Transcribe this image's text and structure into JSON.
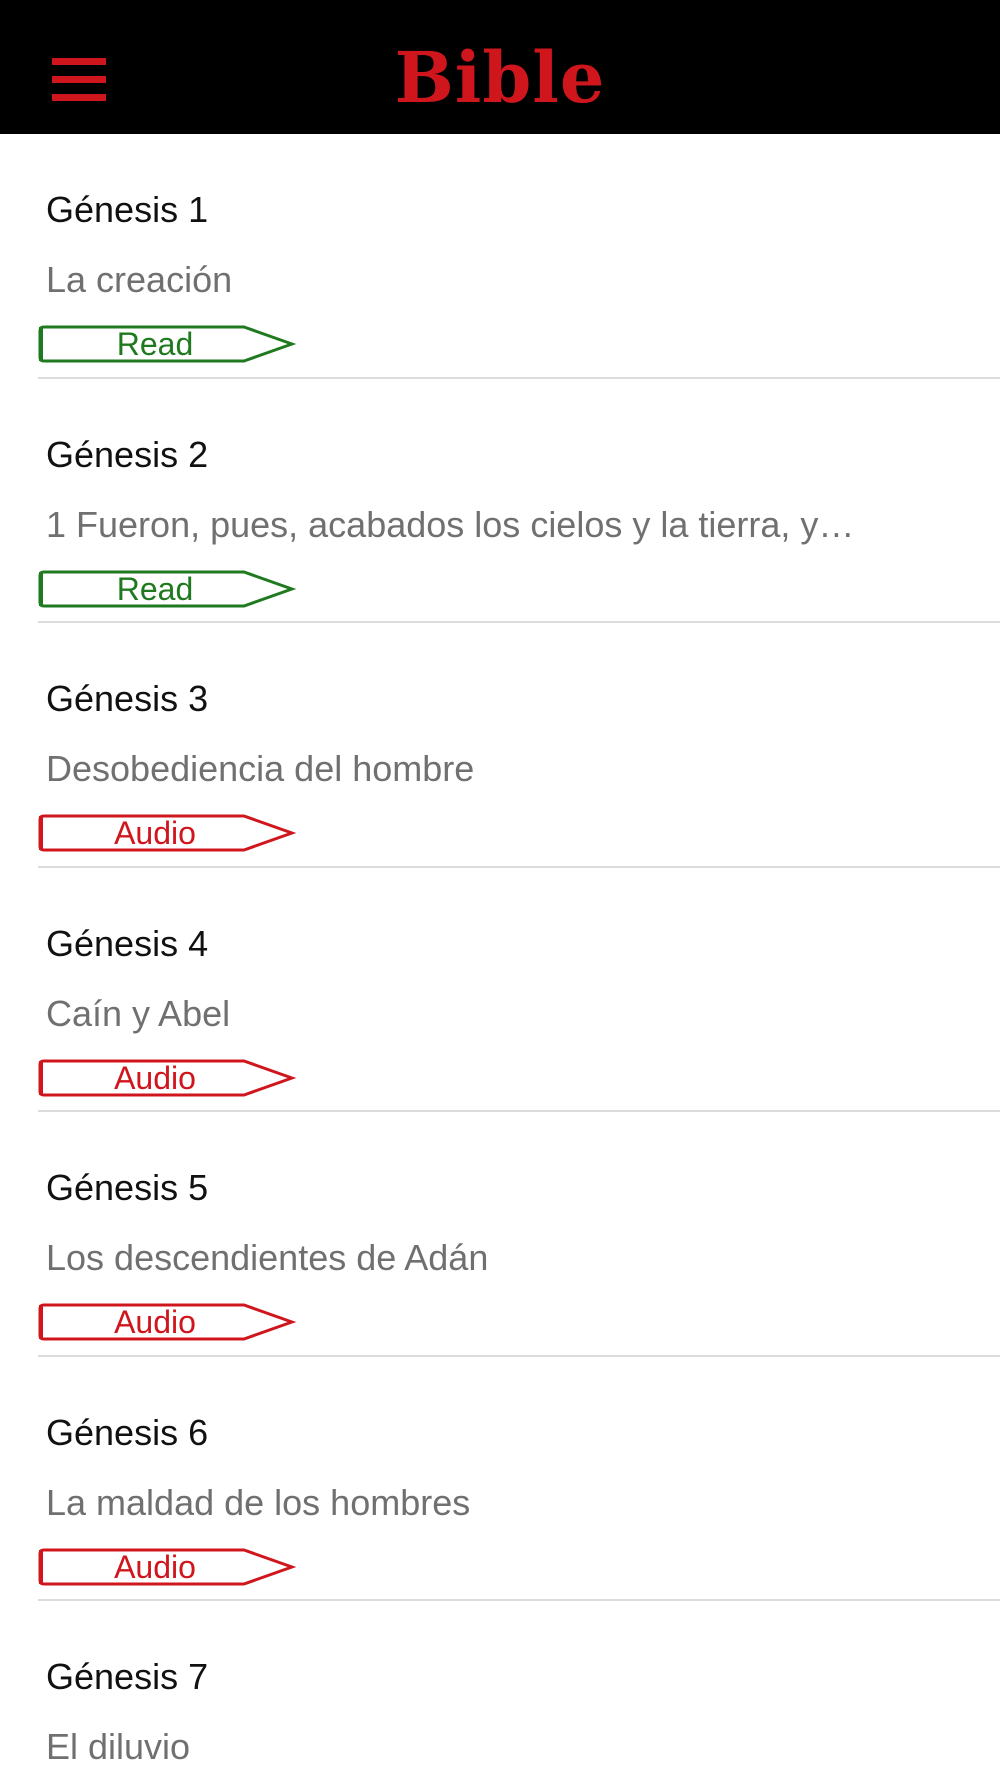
{
  "header": {
    "title": "Bible",
    "menu_icon": "hamburger-menu-icon",
    "background": "#000000",
    "accent": "#d0161d"
  },
  "colors": {
    "read": "#1f7a1f",
    "audio": "#d0161d"
  },
  "chapters": [
    {
      "title": "Génesis 1",
      "subtitle": "La creación",
      "tag": "Read"
    },
    {
      "title": "Génesis 2",
      "subtitle": "1 Fueron, pues, acabados los cielos y la tierra, y…",
      "tag": "Read"
    },
    {
      "title": "Génesis 3",
      "subtitle": "Desobediencia del hombre",
      "tag": "Audio"
    },
    {
      "title": "Génesis 4",
      "subtitle": "Caín y Abel",
      "tag": "Audio"
    },
    {
      "title": "Génesis 5",
      "subtitle": "Los descendientes de Adán",
      "tag": "Audio"
    },
    {
      "title": "Génesis 6",
      "subtitle": "La maldad de los hombres",
      "tag": "Audio"
    },
    {
      "title": "Génesis 7",
      "subtitle": "El diluvio",
      "tag": ""
    }
  ]
}
